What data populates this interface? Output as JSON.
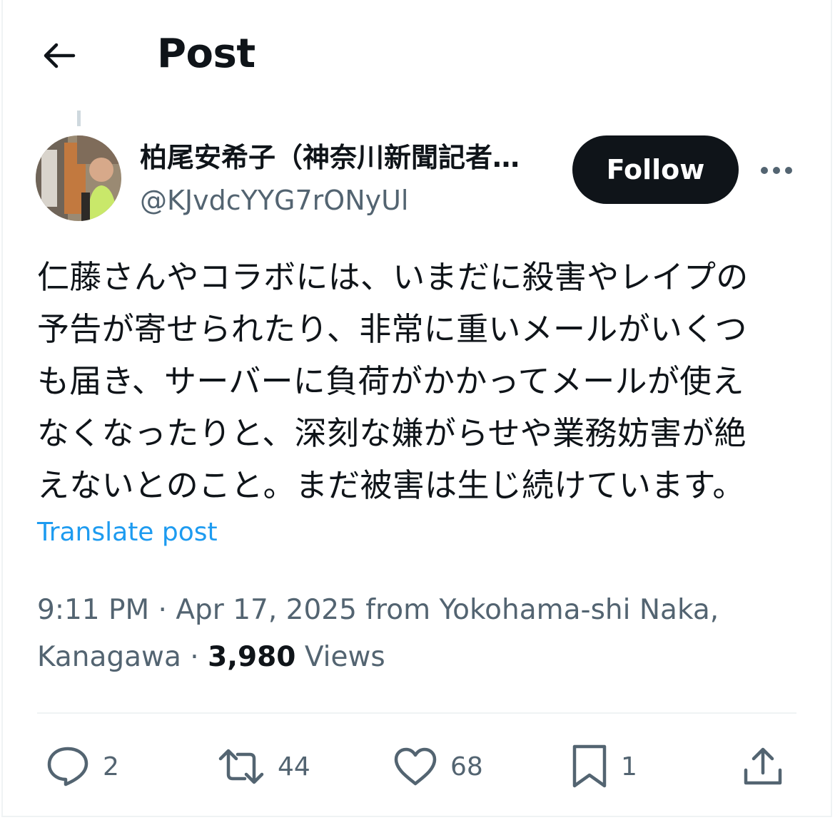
{
  "header": {
    "title": "Post",
    "back_icon": "arrow-left-icon"
  },
  "author": {
    "display_name": "柏尾安希子（神奈川新聞記者…",
    "handle": "@KJvdcYYG7rONyUl",
    "follow_label": "Follow",
    "more_icon": "more-horizontal-icon"
  },
  "post": {
    "lines": [
      "仁藤さんやコラボには、いまだに殺害やレイプの",
      "予告が寄せられたり、非常に重いメールがいくつ",
      "も届き、サーバーに負荷がかかってメールが使え",
      "なくなったりと、深刻な嫌がらせや業務妨害が絶",
      "えないとのこと。まだ被害は生じ続けています。"
    ],
    "translate_label": "Translate post"
  },
  "meta": {
    "time": "9:11 PM",
    "sep1": " · ",
    "date": "Apr 17, 2025",
    "location_prefix": " from ",
    "location_line1": "Yokohama-shi Naka,",
    "location_line2": "Kanagawa",
    "sep2": " · ",
    "views_count": "3,980",
    "views_label": " Views"
  },
  "actions": {
    "replies": "2",
    "reposts": "44",
    "likes": "68",
    "bookmarks": "1"
  },
  "colors": {
    "text": "#0f1419",
    "secondary": "#536471",
    "link": "#1d9bf0",
    "border": "#eff3f4"
  }
}
